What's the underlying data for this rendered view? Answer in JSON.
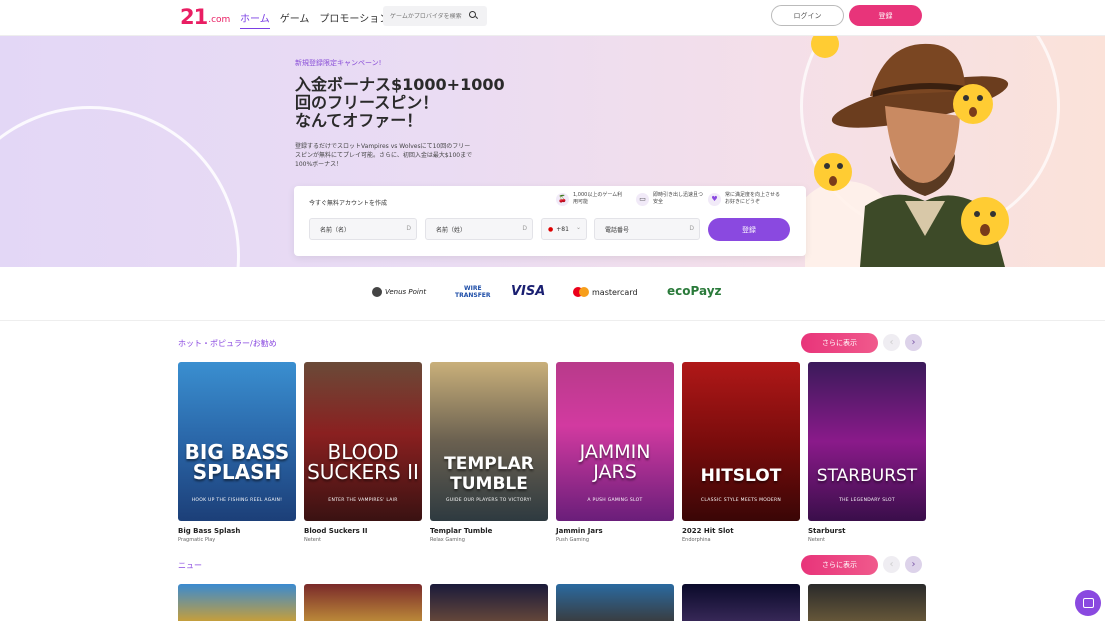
{
  "header": {
    "logo_number": "21",
    "logo_domain": ".com",
    "nav": [
      "ホーム",
      "ゲーム",
      "プロモーション"
    ],
    "search_placeholder": "ゲームかプロバイダを検索",
    "login_label": "ログイン",
    "register_label": "登録"
  },
  "hero": {
    "tag": "新規登録限定キャンペーン!",
    "title": "入金ボーナス$1000+1000\n回のフリースピン！\nなんてオファー！",
    "description": "登録するだけでスロットVampires vs Wolvesにて10回のフリースピンが無料にてプレイ可能。さらに、初回入金は最大$100まで100%ボーナス！",
    "signup": {
      "label": "今すぐ無料アカウントを作成",
      "features": [
        "1,000以上のゲーム利用可能",
        "即時引き出し迅速且つ安全",
        "常に満足度を向上させるお好きにどうぞ"
      ],
      "first_name_placeholder": "名前（名）",
      "last_name_placeholder": "名前（姓）",
      "country_code": "+81",
      "phone_placeholder": "電話番号",
      "submit_label": "登録"
    }
  },
  "payments": [
    "Venus Point",
    "WIRE TRANSFER",
    "VISA",
    "mastercard",
    "ecoPayz"
  ],
  "sections": [
    {
      "title": "ホット・ポピュラー/お勧め",
      "more_label": "さらに表示",
      "games": [
        {
          "name": "Big Bass Splash",
          "provider": "Pragmatic Play",
          "art": "BIG BASS\nSPLASH",
          "tagline": "HOOK UP THE FISHING REEL AGAIN!"
        },
        {
          "name": "Blood Suckers II",
          "provider": "Netent",
          "art": "BLOOD\nSUCKERS II",
          "tagline": "ENTER THE VAMPIRES' LAIR"
        },
        {
          "name": "Templar Tumble",
          "provider": "Relax Gaming",
          "art": "TEMPLAR\nTUMBLE",
          "tagline": "GUIDE OUR PLAYERS TO VICTORY!"
        },
        {
          "name": "Jammin Jars",
          "provider": "Push Gaming",
          "art": "JAMMIN\nJARS",
          "tagline": "A PUSH GAMING SLOT"
        },
        {
          "name": "2022 Hit Slot",
          "provider": "Endorphina",
          "art": "HITSLOT",
          "tagline": "CLASSIC STYLE MEETS MODERN"
        },
        {
          "name": "Starburst",
          "provider": "Netent",
          "art": "STARBURST",
          "tagline": "THE LEGENDARY SLOT"
        }
      ]
    },
    {
      "title": "ニュー",
      "more_label": "さらに表示"
    }
  ],
  "colors": {
    "accent": "#8a49e0",
    "pink": "#e8347a"
  }
}
